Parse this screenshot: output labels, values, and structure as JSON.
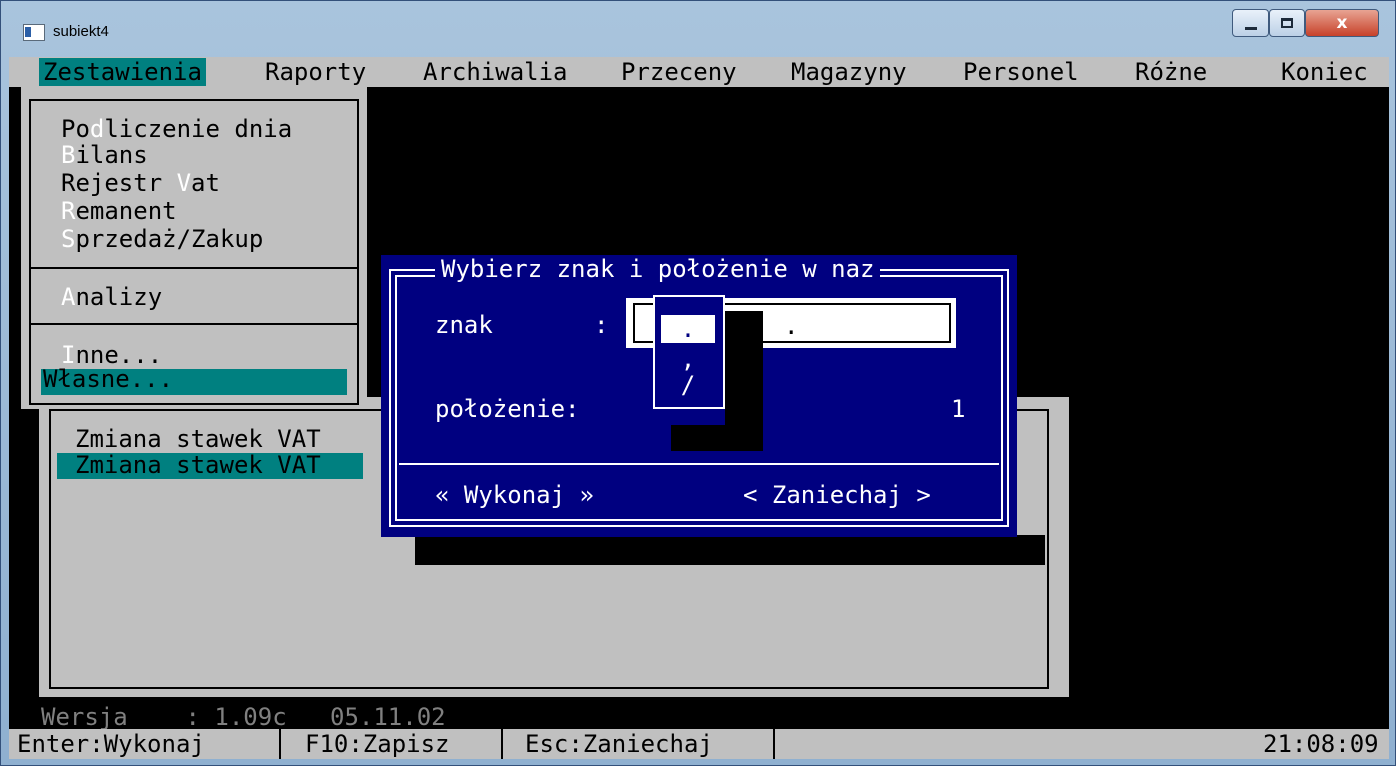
{
  "window": {
    "title": "subiekt4",
    "controls": {
      "minimize": "–",
      "maximize": "□",
      "close": "x"
    }
  },
  "menubar": [
    {
      "label": "Zestawienia",
      "active": true
    },
    {
      "label": "Raporty"
    },
    {
      "label": "Archiwalia"
    },
    {
      "label": "Przeceny"
    },
    {
      "label": "Magazyny"
    },
    {
      "label": "Personel"
    },
    {
      "label": "Różne"
    },
    {
      "label": "Koniec"
    }
  ],
  "dropdown": {
    "groups": [
      [
        {
          "pre": "Po",
          "hot": "d",
          "post": "liczenie dnia"
        },
        {
          "pre": "",
          "hot": "B",
          "post": "ilans"
        },
        {
          "pre": "Rejestr ",
          "hot": "V",
          "post": "at"
        },
        {
          "pre": "",
          "hot": "R",
          "post": "emanent"
        },
        {
          "pre": "",
          "hot": "S",
          "post": "przedaż/Zakup"
        }
      ],
      [
        {
          "pre": "",
          "hot": "A",
          "post": "nalizy"
        }
      ],
      [
        {
          "pre": "",
          "hot": "I",
          "post": "nne..."
        },
        {
          "pre": "Własne...",
          "hot": "",
          "post": "",
          "selected": true
        }
      ]
    ]
  },
  "panel": {
    "items": [
      {
        "label": "Zmiana stawek VAT"
      },
      {
        "label": "Zmiana stawek VAT",
        "selected": true
      }
    ]
  },
  "dialog": {
    "title": "Wybierz znak i położenie w naz",
    "znak_label": "znak       :",
    "znak_value": ".",
    "options": [
      {
        "label": ".",
        "selected": true
      },
      {
        "label": ","
      },
      {
        "label": "/"
      }
    ],
    "polozenie_label": "położenie:",
    "polozenie_value": "1",
    "ok_button": "« Wykonaj »",
    "cancel_button": "< Zaniechaj >"
  },
  "version": {
    "label": "Wersja    : 1.09c",
    "date": "05.11.02"
  },
  "statusbar": {
    "enter": "Enter:Wykonaj",
    "f10": "F10:Zapisz",
    "esc": "Esc:Zaniechaj",
    "time": "21:08:09"
  },
  "colors": {
    "menu_bg": "#c0c0c0",
    "highlight": "#008080",
    "dialog_bg": "#000080",
    "console_bg": "#000000"
  }
}
